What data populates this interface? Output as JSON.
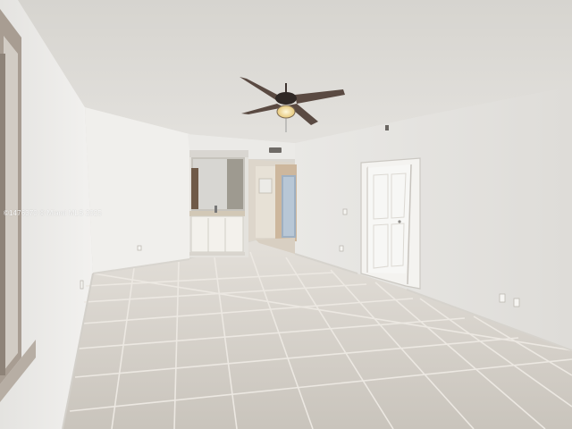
{
  "photo": {
    "watermark": "©1476370 © Miami MLS 2025"
  },
  "colors": {
    "ceiling": "#dcdad5",
    "wall_left": "#f1f0ee",
    "wall_back": "#ebeae7",
    "wall_right": "#e8e7e4",
    "floor_tile": "#cfcac3",
    "grout": "#e6e2dc",
    "fan_blade": "#5a4a42",
    "fan_light": "#f3e4b0"
  },
  "icons": [
    "ceiling-fan-icon",
    "door-icon",
    "vanity-cabinet-icon",
    "mirror-icon",
    "outlet-icon",
    "vent-icon"
  ]
}
